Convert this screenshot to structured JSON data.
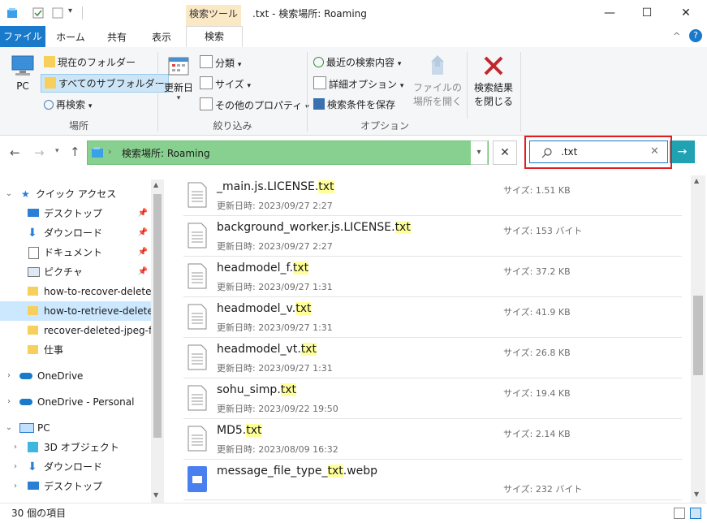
{
  "titlebar": {
    "context_tab": "検索ツール",
    "title": ".txt - 検索場所: Roaming",
    "minimize": "—",
    "maximize": "☐",
    "close": "✕"
  },
  "ribbon_tabs": {
    "file": "ファイル",
    "home": "ホーム",
    "share": "共有",
    "view": "表示",
    "search": "検索"
  },
  "ribbon": {
    "location": {
      "pc": "PC",
      "current_folder": "現在のフォルダー",
      "all_subfolders": "すべてのサブフォルダー",
      "search_again": "再検索",
      "group_label": "場所"
    },
    "refine": {
      "date_modified": "更新日",
      "kind": "分類",
      "size": "サイズ",
      "other_props": "その他のプロパティ",
      "group_label": "絞り込み"
    },
    "options": {
      "recent_searches": "最近の検索内容",
      "advanced_options": "詳細オプション",
      "save_search": "検索条件を保存",
      "open_file_location_1": "ファイルの",
      "open_file_location_2": "場所を開く",
      "close_search_1": "検索結果",
      "close_search_2": "を閉じる",
      "group_label": "オプション"
    },
    "help": "?",
    "collapse": "^"
  },
  "address": {
    "path": "検索場所: Roaming",
    "search_value": ".txt"
  },
  "nav": {
    "quick_access": "クイック アクセス",
    "desktop": "デスクトップ",
    "downloads": "ダウンロード",
    "documents": "ドキュメント",
    "pictures": "ピクチャ",
    "folder1": "how-to-recover-delete",
    "folder2": "how-to-retrieve-delete",
    "folder3": "recover-deleted-jpeg-f",
    "folder4": "仕事",
    "onedrive": "OneDrive",
    "onedrive_personal": "OneDrive - Personal",
    "pc": "PC",
    "pc_3d": "3D オブジェクト",
    "pc_downloads": "ダウンロード",
    "pc_desktop": "デスクトップ"
  },
  "files": [
    {
      "name_pre": "_main.js.LICENSE.",
      "name_hl": "txt",
      "name_post": "",
      "date": "更新日時: 2023/09/27 2:27",
      "size": "サイズ: 1.51 KB"
    },
    {
      "name_pre": "background_worker.js.LICENSE.",
      "name_hl": "txt",
      "name_post": "",
      "date": "更新日時: 2023/09/27 2:27",
      "size": "サイズ: 153 バイト"
    },
    {
      "name_pre": "headmodel_f.",
      "name_hl": "txt",
      "name_post": "",
      "date": "更新日時: 2023/09/27 1:31",
      "size": "サイズ: 37.2 KB"
    },
    {
      "name_pre": "headmodel_v.",
      "name_hl": "txt",
      "name_post": "",
      "date": "更新日時: 2023/09/27 1:31",
      "size": "サイズ: 41.9 KB"
    },
    {
      "name_pre": "headmodel_vt.",
      "name_hl": "txt",
      "name_post": "",
      "date": "更新日時: 2023/09/27 1:31",
      "size": "サイズ: 26.8 KB"
    },
    {
      "name_pre": "sohu_simp.",
      "name_hl": "txt",
      "name_post": "",
      "date": "更新日時: 2023/09/22 19:50",
      "size": "サイズ: 19.4 KB"
    },
    {
      "name_pre": "MD5.",
      "name_hl": "txt",
      "name_post": "",
      "date": "更新日時: 2023/08/09 16:32",
      "size": "サイズ: 2.14 KB"
    },
    {
      "name_pre": "message_file_type_",
      "name_hl": "txt",
      "name_post": ".webp",
      "date": "",
      "size": "サイズ: 232 バイト"
    }
  ],
  "status": {
    "count": "30 個の項目"
  },
  "colors": {
    "accent": "#1979ca",
    "address_green": "#88d08f",
    "highlight": "#ffff9a",
    "search_outline": "#e02020"
  }
}
